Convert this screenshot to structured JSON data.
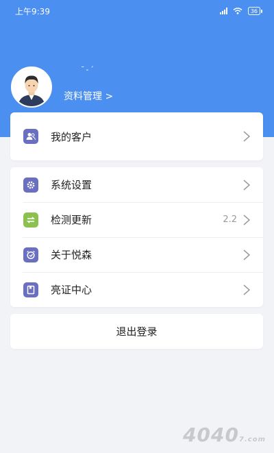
{
  "status_bar": {
    "time": "上午9:39",
    "battery": "36"
  },
  "profile": {
    "username": "ˉ-ˊ",
    "manage_link": "资料管理 >"
  },
  "menu": {
    "customers": {
      "label": "我的客户",
      "icon": "customers-icon"
    },
    "items": [
      {
        "label": "系统设置",
        "icon": "settings-gear-icon",
        "value": ""
      },
      {
        "label": "检测更新",
        "icon": "refresh-update-icon",
        "value": "2.2"
      },
      {
        "label": "关于悦森",
        "icon": "about-clock-icon",
        "value": ""
      },
      {
        "label": "亮证中心",
        "icon": "certificate-icon",
        "value": ""
      }
    ],
    "logout": "退出登录"
  },
  "watermark": {
    "text": "4040",
    "suffix": "7.com"
  },
  "colors": {
    "header_blue": "#4b8ff0",
    "icon_purple": "#6b6fbf",
    "icon_green": "#8cc152",
    "background": "#f2f3f7"
  }
}
